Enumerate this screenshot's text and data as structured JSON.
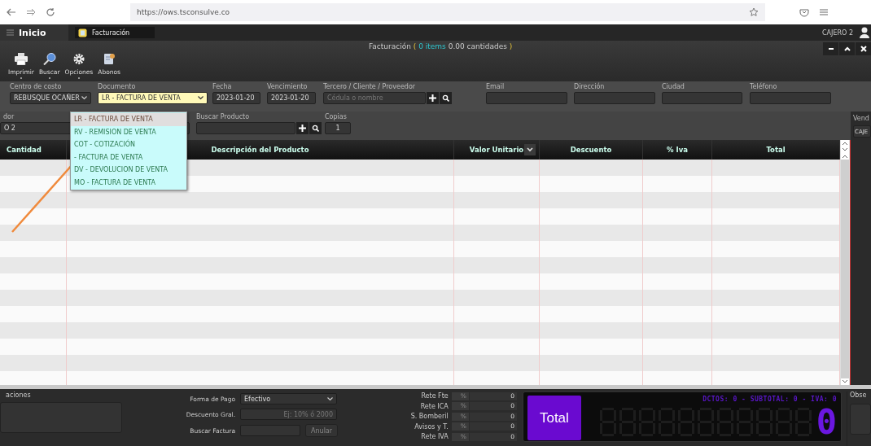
{
  "browser": {
    "url": "https://ows.tsconsulve.co"
  },
  "app": {
    "home": "Inicio",
    "tabs": [
      {
        "label": "Facturación",
        "selected": true
      }
    ],
    "user": "CAJERO 2"
  },
  "window": {
    "title": "Facturación",
    "paren_open": "(",
    "items": "0 items",
    "quantities": "0.00 cantidades",
    "paren_close": ")"
  },
  "toolbar": [
    {
      "label": "Imprimir",
      "menu": true
    },
    {
      "label": "Buscar",
      "menu": true
    },
    {
      "label": "Opciones",
      "menu": true
    },
    {
      "label": "Abonos",
      "menu": false
    }
  ],
  "form_row_1": [
    {
      "label": "Centro de costo",
      "kind": "select",
      "value": "REBUSQUE OCAÑER",
      "focused": false
    },
    {
      "label": "Documento",
      "kind": "select",
      "value": "LR - FACTURA DE VENTA",
      "focused": true
    },
    {
      "label": "Fecha",
      "kind": "text",
      "value": "2023-01-20",
      "focused": false
    },
    {
      "label": "Vencimiento",
      "kind": "text",
      "value": "2023-01-20",
      "focused": false
    },
    {
      "label": "Tercero / Cliente / Proveedor",
      "kind": "search",
      "placeholder": "Cédula o nombre",
      "focused": false
    },
    {
      "label": "Email",
      "kind": "text",
      "focused": false
    },
    {
      "label": "Dirección",
      "kind": "text",
      "focused": false
    },
    {
      "label": "Ciudad",
      "kind": "text",
      "focused": false
    },
    {
      "label": "Teléfono",
      "kind": "text",
      "focused": false
    }
  ],
  "form_row_2": [
    {
      "label": "dor",
      "kind": "text",
      "value": "O 2"
    },
    {
      "label": "Buscar Producto",
      "kind": "search"
    },
    {
      "label": "Copias",
      "kind": "text",
      "value": "1"
    }
  ],
  "side_field": {
    "label": "Vend",
    "value": "CAJE"
  },
  "document_dropdown": [
    {
      "label": "LR - FACTURA DE VENTA",
      "selected": true
    },
    {
      "label": "RV - REMISION DE VENTA",
      "selected": false
    },
    {
      "label": "COT - COTIZACIÓN",
      "selected": false
    },
    {
      "label": "- FACTURA DE VENTA",
      "selected": false
    },
    {
      "label": "DV - DEVOLUCION DE VENTA",
      "selected": false
    },
    {
      "label": "MO - FACTURA DE VENTA",
      "selected": false
    }
  ],
  "table": {
    "columns": [
      {
        "label": "Cantidad",
        "menu": false
      },
      {
        "label": "Descripción del Producto",
        "menu": false
      },
      {
        "label": "Valor Unitario",
        "menu": true
      },
      {
        "label": "Descuento",
        "menu": false
      },
      {
        "label": "% Iva",
        "menu": false
      },
      {
        "label": "Total",
        "menu": false
      }
    ]
  },
  "observations": {
    "label": "aciones"
  },
  "payment": [
    {
      "label": "Forma de Pago",
      "kind": "select",
      "value": "Efectivo"
    },
    {
      "label": "Descuento Gral.",
      "kind": "text",
      "placeholder": "Ej: 10% ó 2000"
    },
    {
      "label": "Buscar Factura",
      "kind": "button",
      "button": "Anular"
    }
  ],
  "retentions": [
    {
      "label": "Rete Fte",
      "percent": "%",
      "value": "0"
    },
    {
      "label": "Rete ICA",
      "percent": "%",
      "value": "0"
    },
    {
      "label": "S. Bomberil",
      "percent": "%",
      "value": "0"
    },
    {
      "label": "Avisos y T.",
      "percent": "%",
      "value": "0"
    },
    {
      "label": "Rete IVA",
      "percent": "%",
      "value": "0"
    }
  ],
  "total": {
    "button": "Total",
    "summary": "DCTOS: 0 - SUBTOTAL: 0 - IVA: 0",
    "display": "0"
  },
  "side_observations": {
    "label": "Obse"
  }
}
